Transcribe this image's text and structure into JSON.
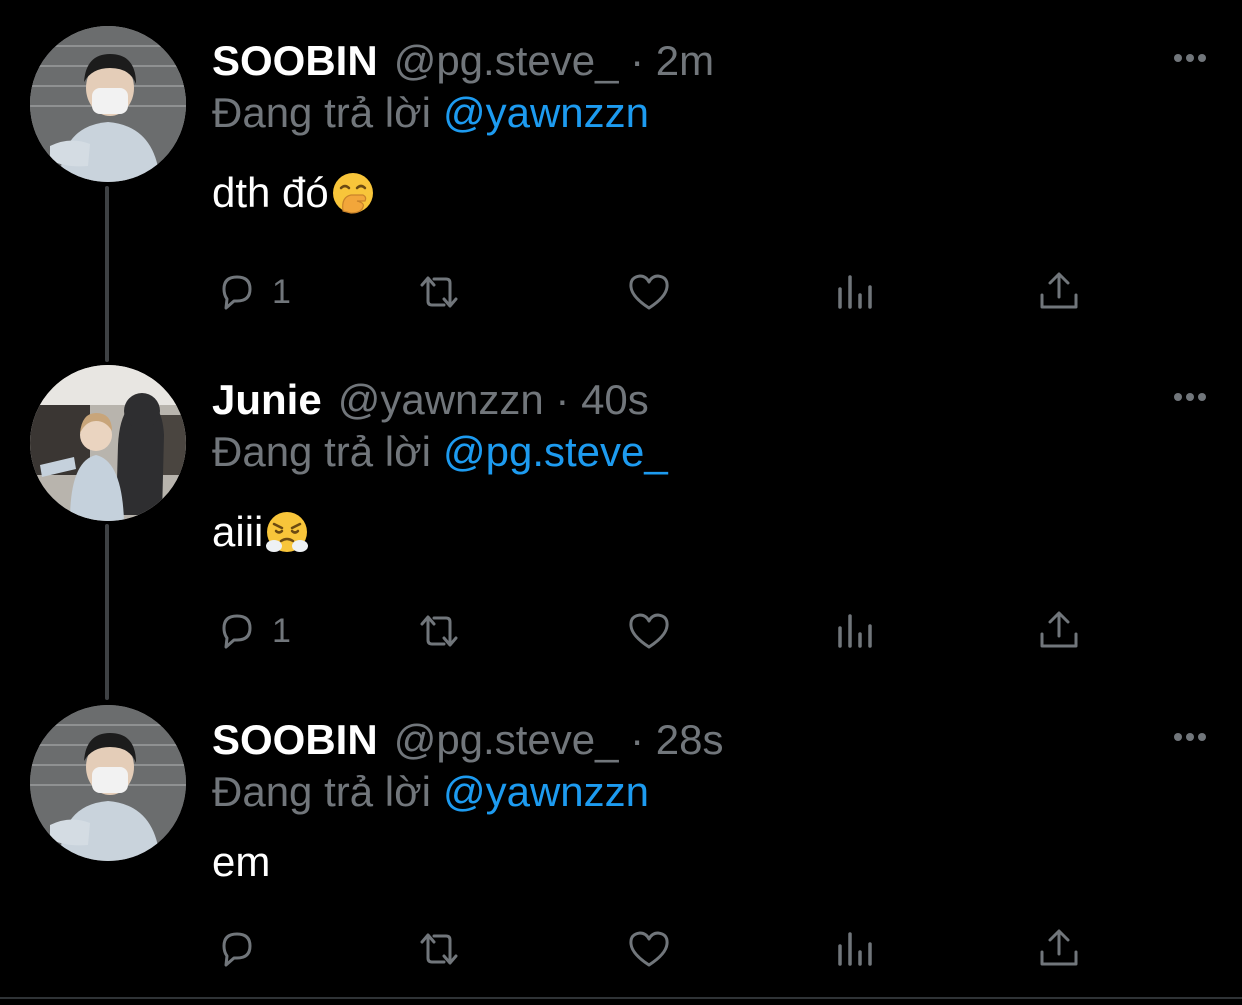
{
  "colors": {
    "background": "#000000",
    "name": "#ffffff",
    "muted": "#71767b",
    "mention": "#1d9bf0",
    "thread_line": "#3e4144"
  },
  "tweets": [
    {
      "display_name": "SOOBIN",
      "meta": "@pg.steve_ · 2m",
      "replying_prefix": "Đang trả lời",
      "replying_to": "@yawnzzn",
      "text": "dth đó",
      "emoji": "hand-over-mouth-emoji",
      "reply_count": "1",
      "avatar": "masked-man-avatar"
    },
    {
      "display_name": "Junie",
      "meta": "@yawnzzn · 40s",
      "replying_prefix": "Đang trả lời",
      "replying_to": "@pg.steve_",
      "text": "aiii",
      "emoji": "face-with-steam-emoji",
      "reply_count": "1",
      "avatar": "girl-with-mascot-avatar"
    },
    {
      "display_name": "SOOBIN",
      "meta": "@pg.steve_ · 28s",
      "replying_prefix": "Đang trả lời",
      "replying_to": "@yawnzzn",
      "text": "em",
      "emoji": "",
      "reply_count": "",
      "avatar": "masked-man-avatar"
    }
  ],
  "icons": {
    "reply": "speech-bubble-icon",
    "retweet": "retweet-icon",
    "like": "heart-icon",
    "views": "bar-chart-icon",
    "share": "share-upload-icon",
    "more": "ellipsis-icon"
  }
}
